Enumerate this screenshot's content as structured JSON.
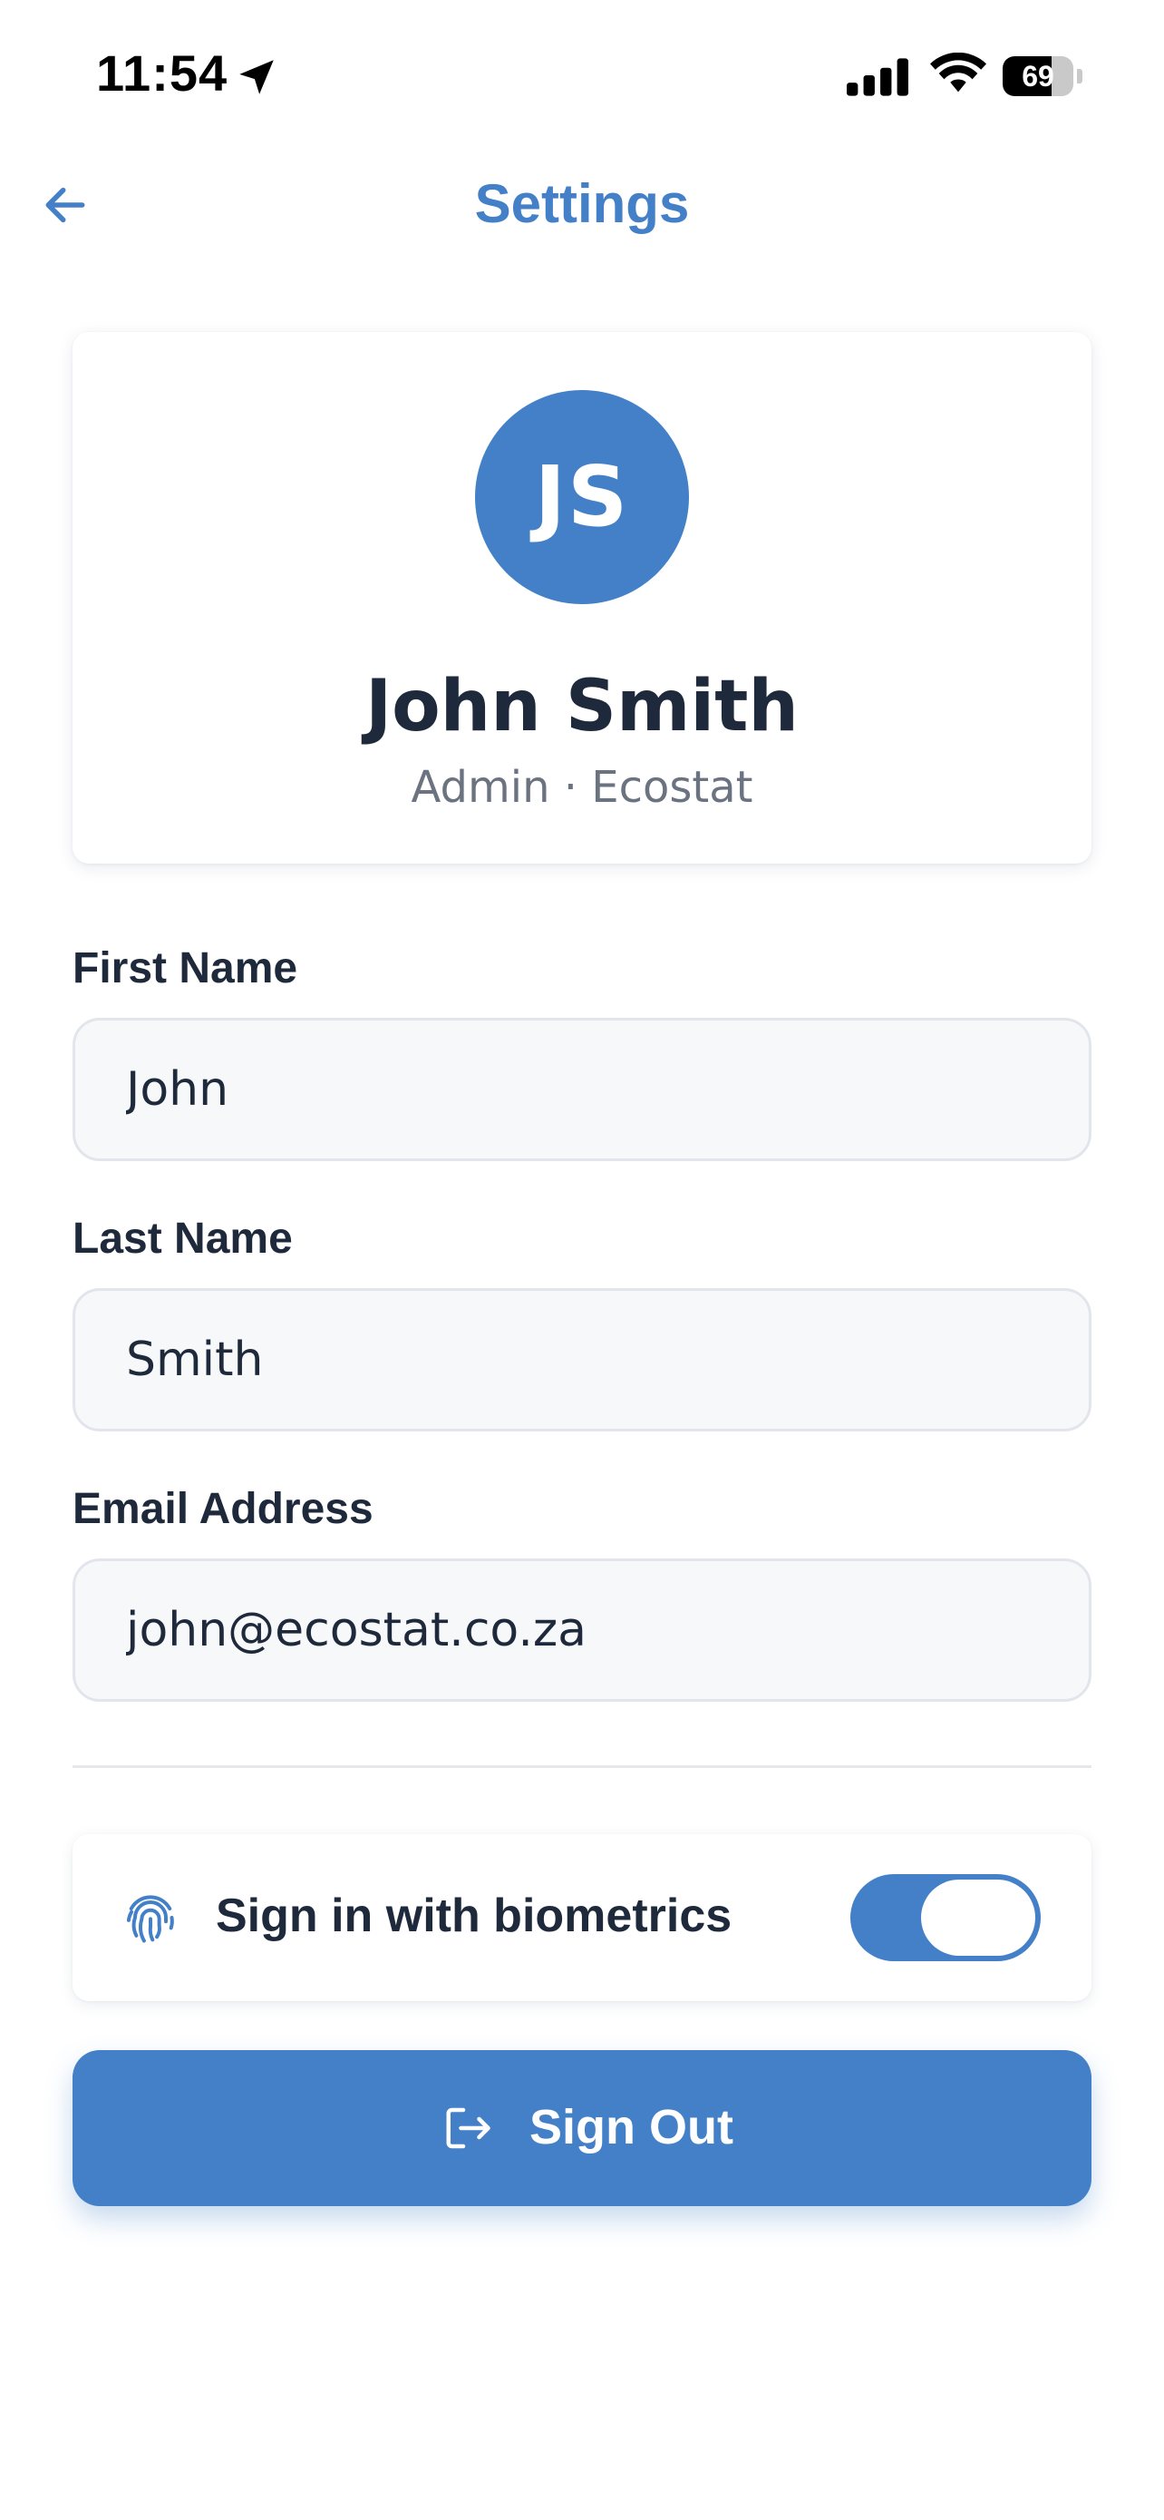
{
  "status_bar": {
    "time": "11:54",
    "battery_percent": "69",
    "battery_level": 0.69,
    "icons": [
      "location-arrow-icon",
      "cellular-signal-icon",
      "wifi-icon",
      "battery-icon"
    ]
  },
  "nav": {
    "title": "Settings",
    "back_icon": "arrow-left-icon"
  },
  "profile": {
    "initials": "JS",
    "name": "John Smith",
    "subtitle": "Admin · Ecostat"
  },
  "form": {
    "first_name": {
      "label": "First Name",
      "value": "John"
    },
    "last_name": {
      "label": "Last Name",
      "value": "Smith"
    },
    "email": {
      "label": "Email Address",
      "value": "john@ecostat.co.za"
    }
  },
  "biometrics": {
    "label": "Sign in with biometrics",
    "icon": "fingerprint-icon",
    "enabled": true
  },
  "sign_out": {
    "label": "Sign Out",
    "icon": "sign-out-icon"
  },
  "colors": {
    "accent": "#4380c8",
    "text": "#1e293b",
    "muted": "#6b7280",
    "input_bg": "#f7f8fa",
    "input_border": "#e2e6ec"
  }
}
